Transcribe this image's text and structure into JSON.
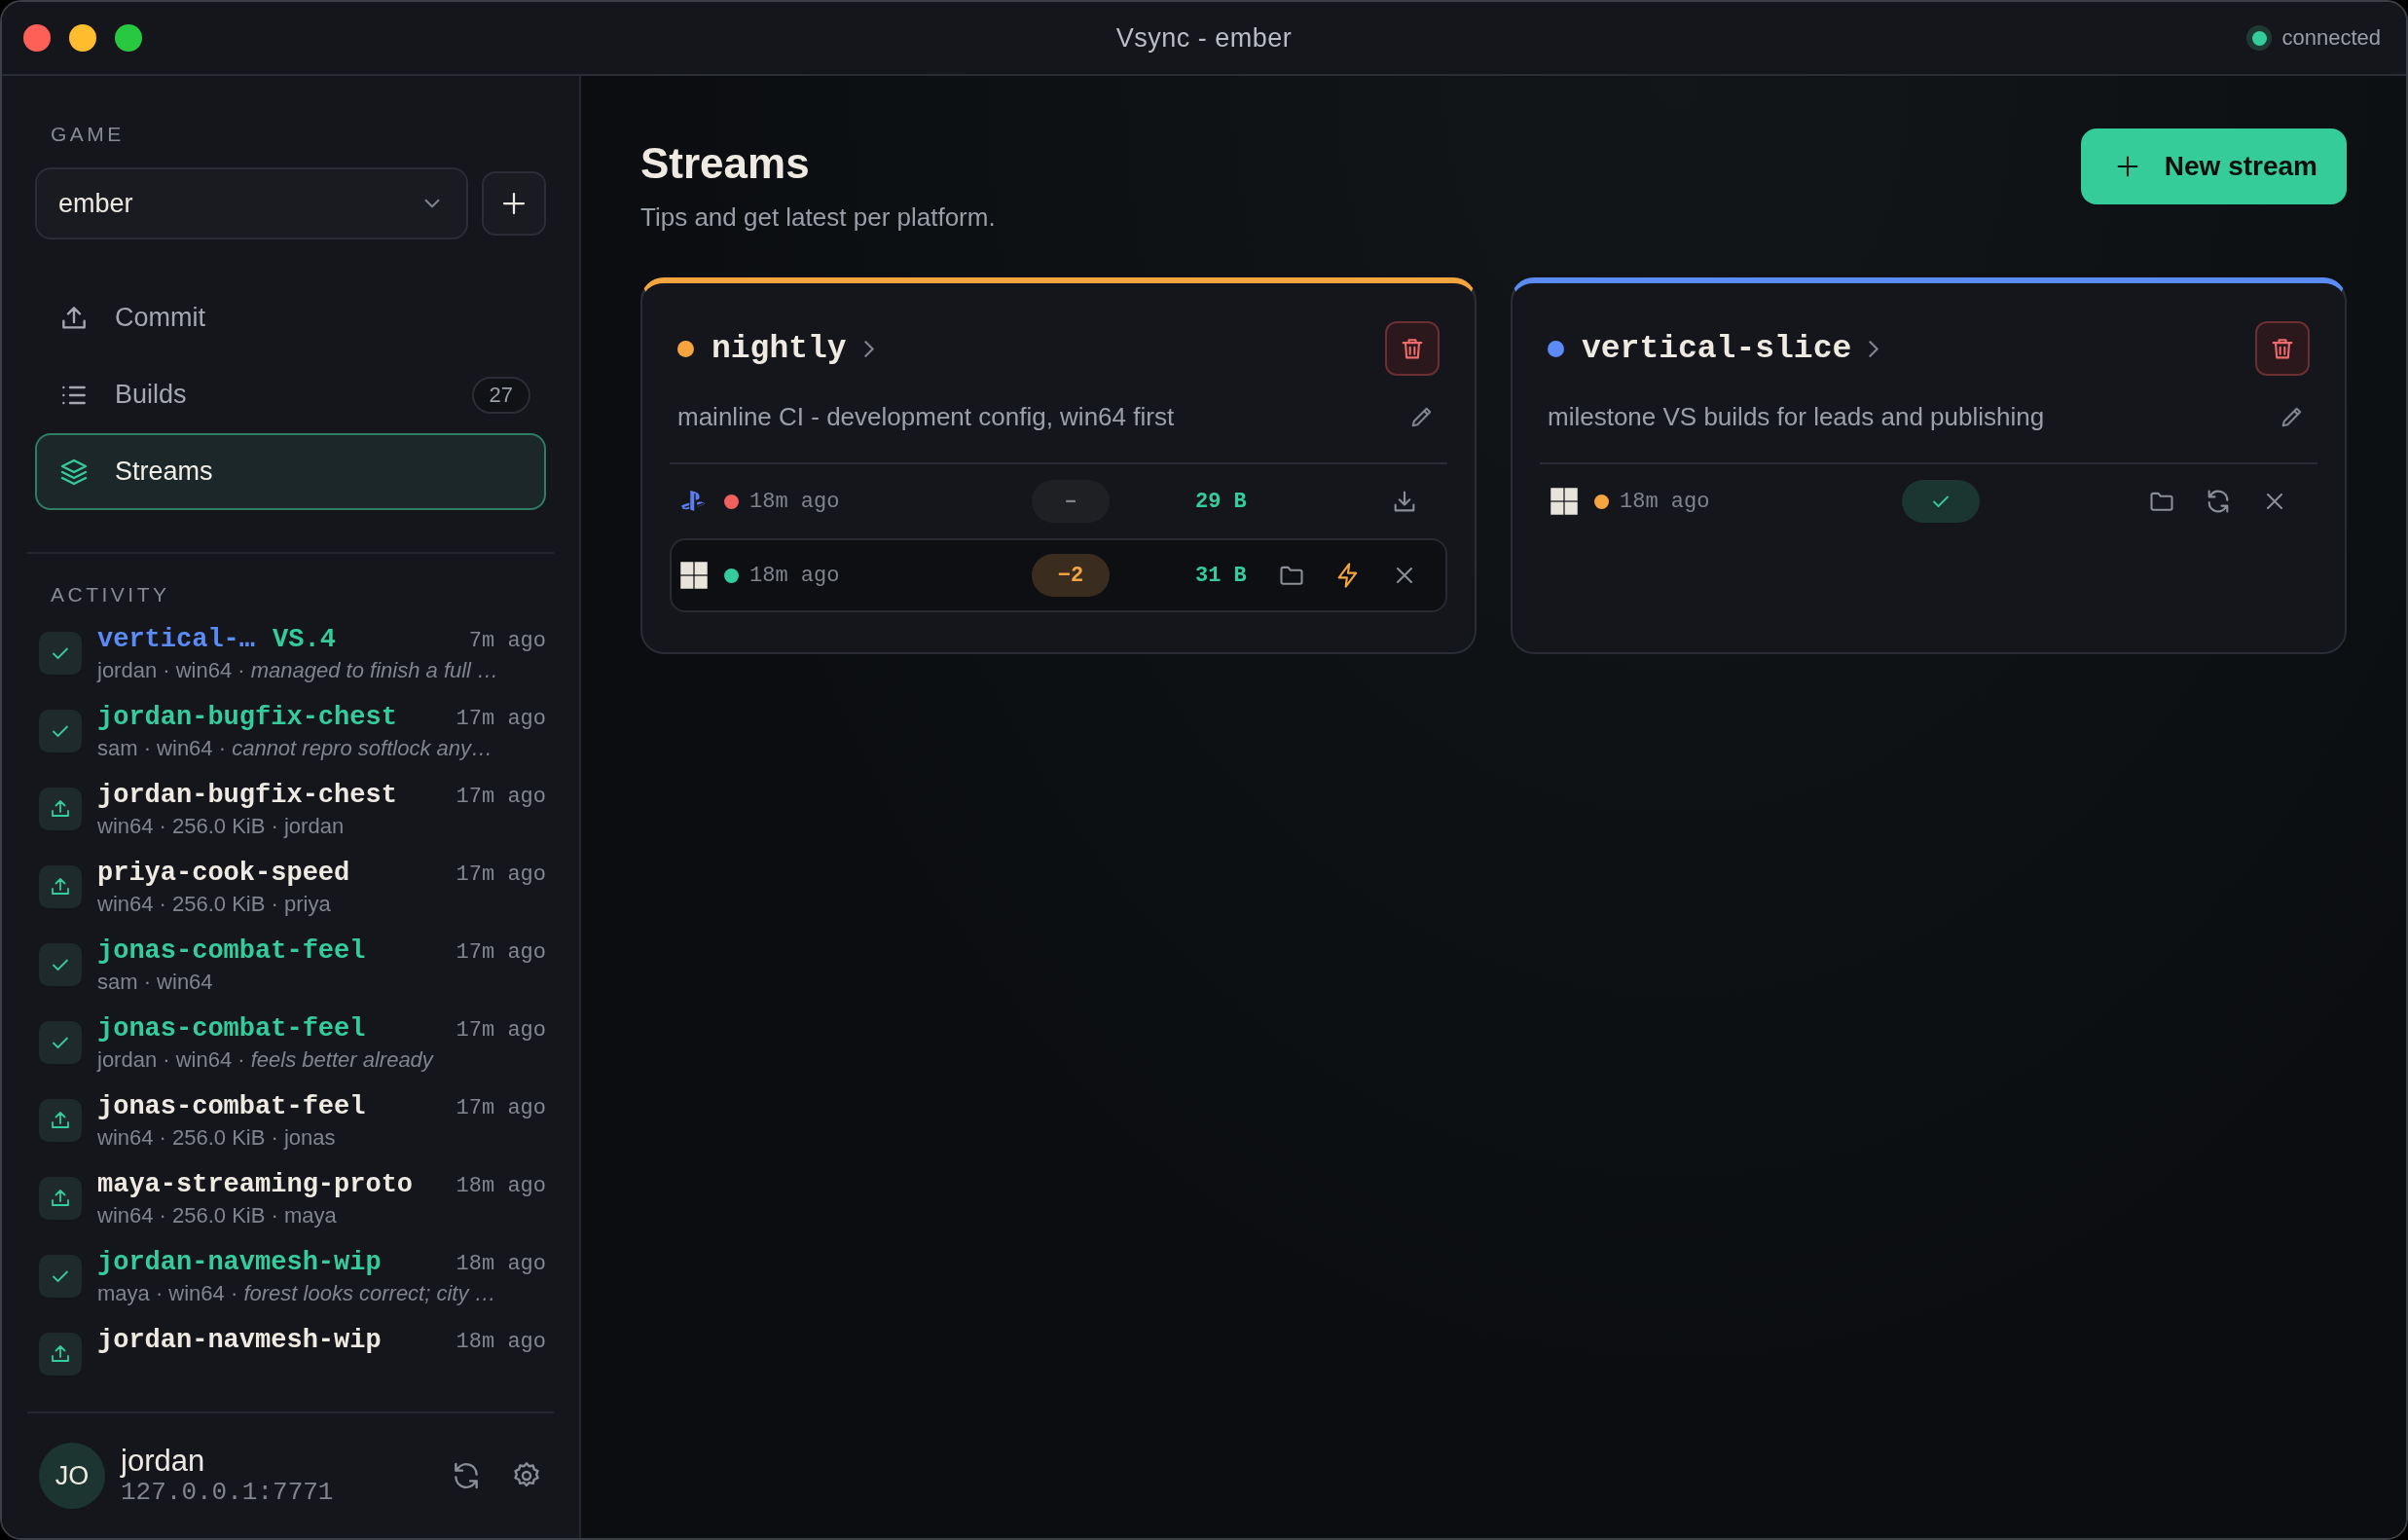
{
  "window": {
    "title": "Vsync - ember",
    "status": {
      "label": "connected",
      "color": "#34cc9a"
    }
  },
  "sidebar": {
    "game_label": "GAME",
    "game_select": {
      "value": "ember"
    },
    "nav": [
      {
        "label": "Commit",
        "selected": false
      },
      {
        "label": "Builds",
        "badge": "27",
        "selected": false
      },
      {
        "label": "Streams",
        "selected": true
      }
    ],
    "activity_label": "ACTIVITY",
    "activity": [
      {
        "kind": "check",
        "stream": "vertical-…",
        "color": "#5b8cf6",
        "title": "VS.4",
        "time": "7m ago",
        "meta": "jordan · win64 · *managed to finish a full …*"
      },
      {
        "kind": "check",
        "title": "jordan-bugfix-chest",
        "time": "17m ago",
        "meta": "sam · win64 · *cannot repro softlock any…*"
      },
      {
        "kind": "upload",
        "title": "jordan-bugfix-chest",
        "time": "17m ago",
        "meta": "win64 · 256.0 KiB · jordan"
      },
      {
        "kind": "upload",
        "title": "priya-cook-speed",
        "time": "17m ago",
        "meta": "win64 · 256.0 KiB · priya"
      },
      {
        "kind": "check",
        "title": "jonas-combat-feel",
        "time": "17m ago",
        "meta": "sam · win64"
      },
      {
        "kind": "check",
        "title": "jonas-combat-feel",
        "time": "17m ago",
        "meta": "jordan · win64 · *feels better already*"
      },
      {
        "kind": "upload",
        "title": "jonas-combat-feel",
        "time": "17m ago",
        "meta": "win64 · 256.0 KiB · jonas"
      },
      {
        "kind": "upload",
        "title": "maya-streaming-proto",
        "time": "18m ago",
        "meta": "win64 · 256.0 KiB · maya"
      },
      {
        "kind": "check",
        "title": "jordan-navmesh-wip",
        "time": "18m ago",
        "meta": "maya · win64 · *forest looks correct; city …*"
      },
      {
        "kind": "upload",
        "title": "jordan-navmesh-wip",
        "time": "18m ago"
      }
    ],
    "user": {
      "initials": "JO",
      "name": "jordan",
      "address": "127.0.0.1:7771"
    }
  },
  "main": {
    "title": "Streams",
    "subtitle": "Tips and get latest per platform.",
    "new_button": "New stream",
    "streams": [
      {
        "name": "nightly",
        "color": "#f5a540",
        "description": "mainline CI - development config, win64 first",
        "rows": [
          {
            "kind": "console",
            "color": "#f0605f",
            "time": "18m ago",
            "result": {
              "kind": "neutral",
              "label": "–"
            },
            "size": "29 B",
            "actions": [
              {
                "kind": "download"
              }
            ],
            "highlighted": false
          },
          {
            "kind": "grid",
            "color": "#34cc9a",
            "time": "18m ago",
            "result": {
              "kind": "warning",
              "label": "−2"
            },
            "size": "31 B",
            "actions": [
              {
                "kind": "folder"
              },
              {
                "kind": "bolt"
              },
              {
                "kind": "close"
              }
            ],
            "highlighted": true
          }
        ]
      },
      {
        "name": "vertical-slice",
        "color": "#5b8cf6",
        "description": "milestone VS builds for leads and publishing",
        "rows": [
          {
            "kind": "grid",
            "color": "#f5a540",
            "time": "18m ago",
            "result": {
              "kind": "ok"
            },
            "actions": [
              {
                "kind": "folder"
              },
              {
                "kind": "refresh"
              },
              {
                "kind": "close"
              }
            ],
            "highlighted": false
          }
        ]
      }
    ]
  }
}
